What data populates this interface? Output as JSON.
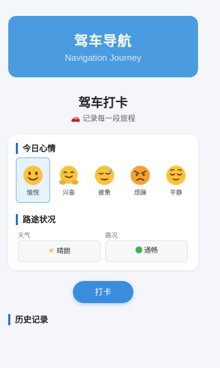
{
  "header": {
    "title": "驾车导航",
    "subtitle": "Navigation Journey"
  },
  "page": {
    "title": "驾车打卡",
    "subtitle": "记录每一段旅程",
    "subtitle_icon": "car-icon"
  },
  "mood_section": {
    "title": "今日心情",
    "items": [
      {
        "label": "愉悦",
        "icon": "smiling-face-icon",
        "selected": true
      },
      {
        "label": "兴奋",
        "icon": "hugging-face-icon",
        "selected": false
      },
      {
        "label": "疲惫",
        "icon": "sweating-face-icon",
        "selected": false
      },
      {
        "label": "烦躁",
        "icon": "angry-face-icon",
        "selected": false
      },
      {
        "label": "平静",
        "icon": "relieved-face-icon",
        "selected": false
      }
    ]
  },
  "road_section": {
    "title": "路途状况",
    "weather": {
      "label": "天气",
      "value": "晴朗",
      "icon": "sun-icon"
    },
    "traffic": {
      "label": "路况",
      "value": "通畅",
      "icon": "green-dot-icon"
    }
  },
  "actions": {
    "checkin_label": "打卡"
  },
  "history": {
    "title": "历史记录"
  },
  "colors": {
    "accent": "#4a9be0",
    "button": "#3a8cde",
    "section_bar": "#2a6fc2",
    "traffic_ok": "#3cb44b",
    "emoji_face": "#fbc33b"
  }
}
